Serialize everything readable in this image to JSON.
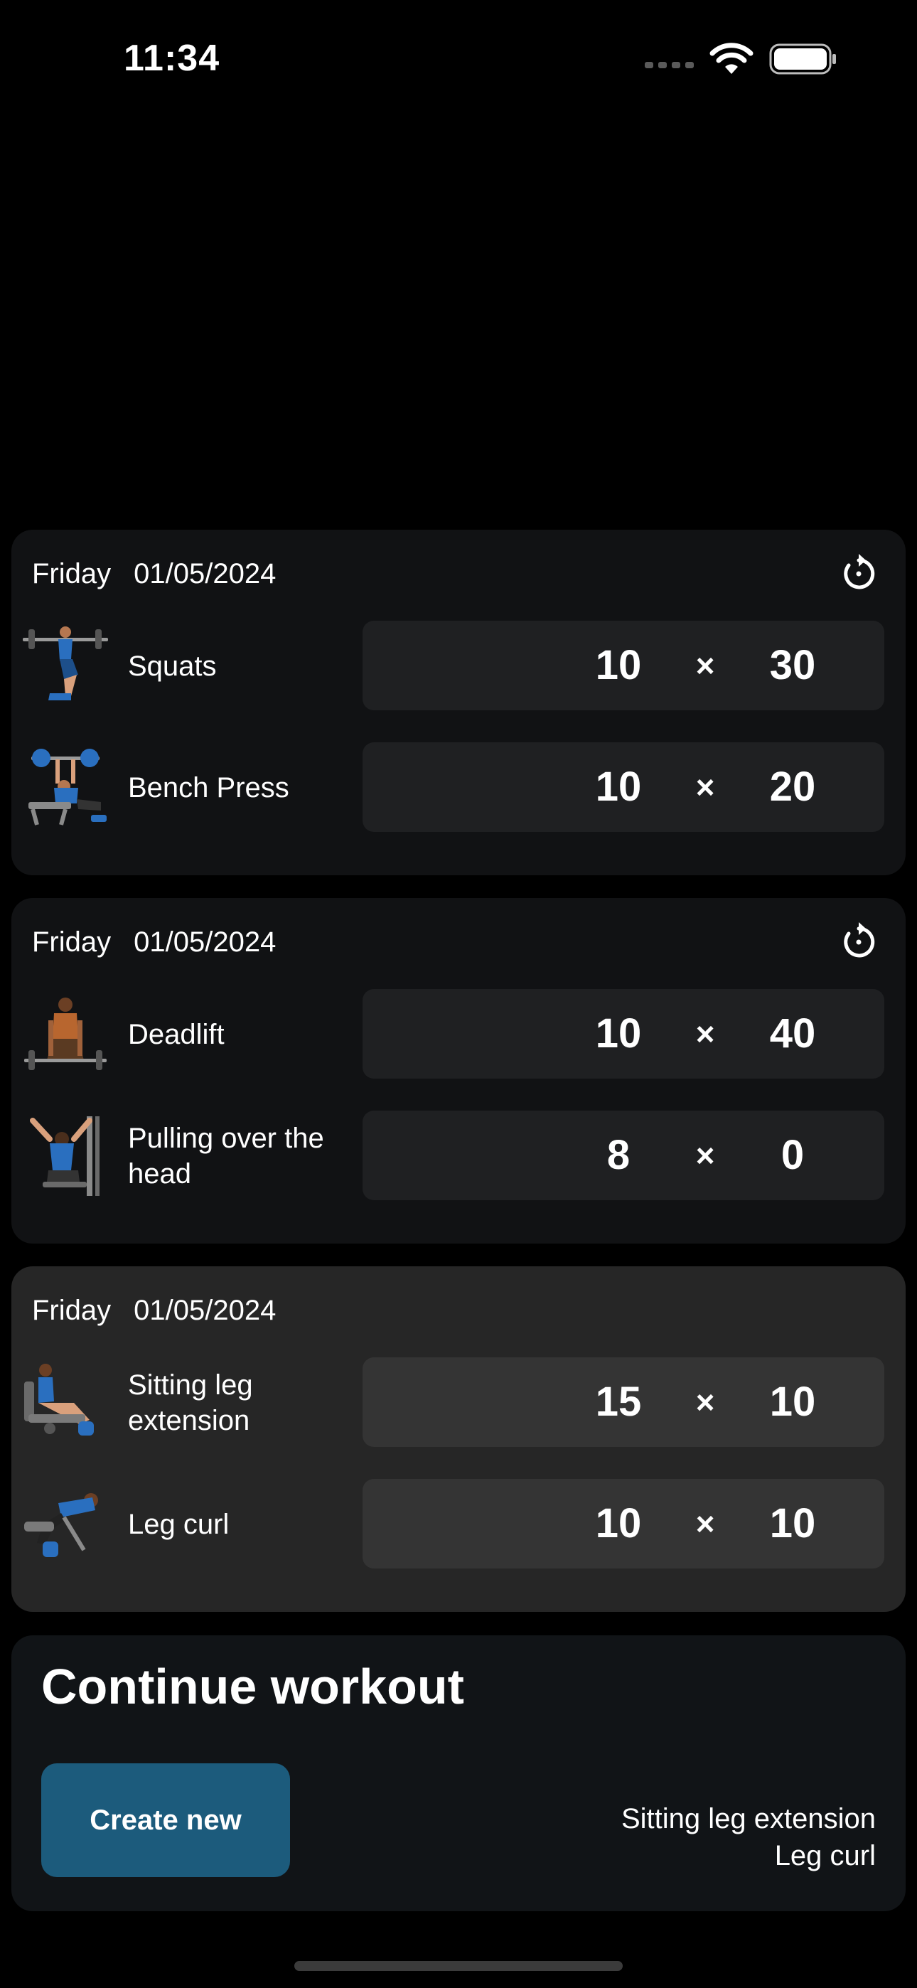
{
  "status_bar": {
    "time": "11:34",
    "icons": [
      "signal-dots-icon",
      "wifi-icon",
      "battery-icon"
    ]
  },
  "workouts": [
    {
      "day": "Friday",
      "date": "01/05/2024",
      "has_reset": true,
      "selected": false,
      "exercises": [
        {
          "name": "Squats",
          "icon": "squat-figure-icon",
          "reps": "10",
          "times": "×",
          "weight": "30"
        },
        {
          "name": "Bench Press",
          "icon": "bench-press-figure-icon",
          "reps": "10",
          "times": "×",
          "weight": "20"
        }
      ]
    },
    {
      "day": "Friday",
      "date": "01/05/2024",
      "has_reset": true,
      "selected": false,
      "exercises": [
        {
          "name": "Deadlift",
          "icon": "deadlift-figure-icon",
          "reps": "10",
          "times": "×",
          "weight": "40"
        },
        {
          "name": "Pulling over the head",
          "icon": "lat-pulldown-figure-icon",
          "reps": "8",
          "times": "×",
          "weight": "0"
        }
      ]
    },
    {
      "day": "Friday",
      "date": "01/05/2024",
      "has_reset": false,
      "selected": true,
      "exercises": [
        {
          "name": "Sitting leg extension",
          "icon": "leg-extension-figure-icon",
          "reps": "15",
          "times": "×",
          "weight": "10"
        },
        {
          "name": "Leg curl",
          "icon": "leg-curl-figure-icon",
          "reps": "10",
          "times": "×",
          "weight": "10"
        }
      ]
    }
  ],
  "continue": {
    "title": "Continue workout",
    "button_label": "Create new",
    "exercises": [
      "Sitting leg extension",
      "Leg curl"
    ]
  },
  "colors": {
    "background": "#000000",
    "card": "#111214",
    "card_selected": "#262626",
    "button": "#1c5b7c"
  }
}
